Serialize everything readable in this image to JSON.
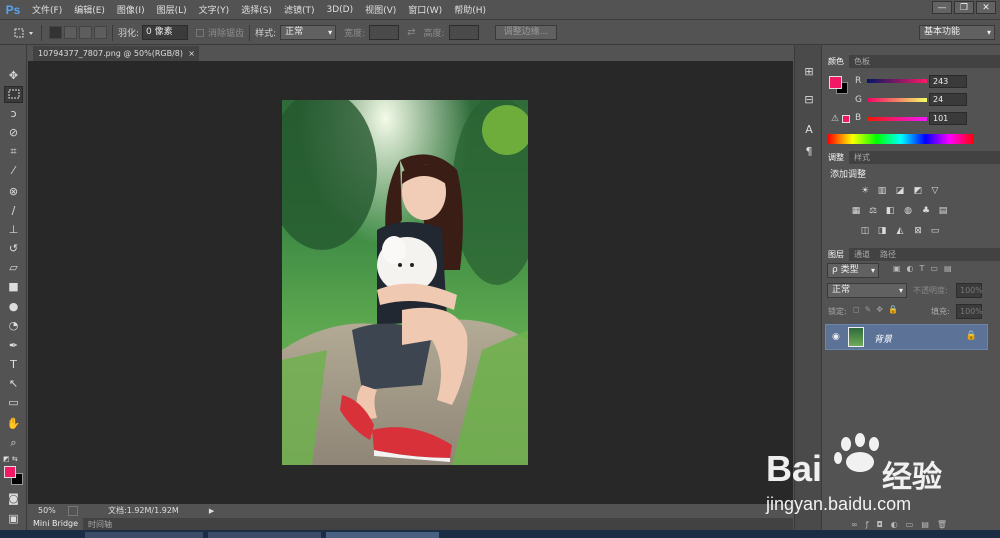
{
  "app": {
    "logo": "Ps",
    "menus": [
      "文件(F)",
      "编辑(E)",
      "图像(I)",
      "图层(L)",
      "文字(Y)",
      "选择(S)",
      "滤镜(T)",
      "3D(D)",
      "视图(V)",
      "窗口(W)",
      "帮助(H)"
    ],
    "win_min": "—",
    "win_max": "❐",
    "win_close": "✕"
  },
  "options": {
    "feather_label": "羽化:",
    "feather_value": "0 像素",
    "antialias": "消除锯齿",
    "style_label": "样式:",
    "style_value": "正常",
    "width_label": "宽度:",
    "height_label": "高度:",
    "refine_button": "调整边缘...",
    "workspace": "基本功能"
  },
  "document": {
    "tab_title": "10794377_7807.png @ 50%(RGB/8)",
    "close": "×"
  },
  "status": {
    "zoom": "50%",
    "doc_size": "文档:1.92M/1.92M",
    "arrow": "▶"
  },
  "bottom": {
    "tab1": "Mini Bridge",
    "tab2": "时间轴"
  },
  "color_panel": {
    "tab1": "颜色",
    "tab2": "色板",
    "r_label": "R",
    "g_label": "G",
    "b_label": "B",
    "r": "243",
    "g": "24",
    "b": "101",
    "fg": "#f31865",
    "bg": "#000000"
  },
  "adjust_panel": {
    "tab1": "调整",
    "tab2": "样式",
    "title": "添加调整"
  },
  "layers_panel": {
    "tab1": "图层",
    "tab2": "通道",
    "tab3": "路径",
    "kind": "ρ 类型",
    "blend": "正常",
    "opacity_label": "不透明度:",
    "opacity_value": "100%",
    "lock_label": "锁定:",
    "fill_label": "填充:",
    "fill_value": "100%",
    "layer_name": "背景"
  },
  "watermark": {
    "brand": "Bai",
    "brand2": "经验",
    "url": "jingyan.baidu.com"
  }
}
